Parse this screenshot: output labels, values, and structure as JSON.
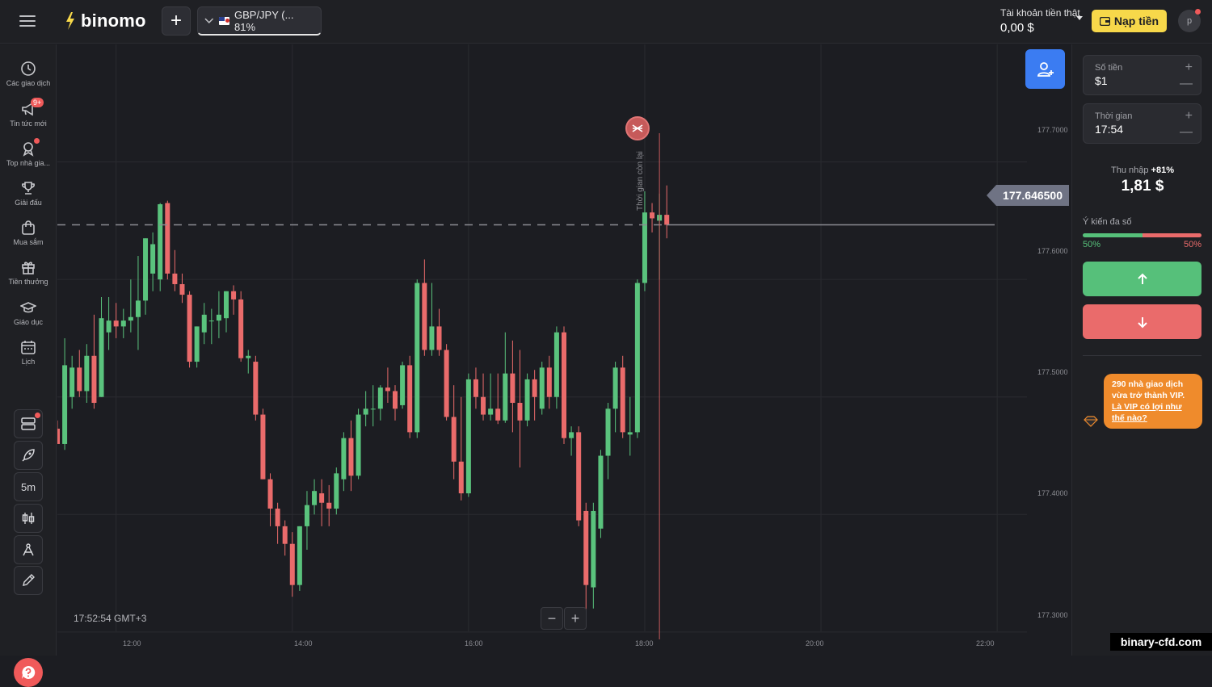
{
  "header": {
    "logo_text": "binomo",
    "asset_label": "GBP/JPY (... 81%",
    "account_type": "Tài khoản tiền thật",
    "balance": "0,00 $",
    "deposit_label": "Nạp tiền",
    "avatar_initial": "p"
  },
  "sidebar": {
    "items": [
      {
        "label": "Các giao dịch",
        "icon": "clock-icon"
      },
      {
        "label": "Tin tức mới",
        "icon": "megaphone-icon",
        "badge": "9+"
      },
      {
        "label": "Top nhà gia...",
        "icon": "medal-icon"
      },
      {
        "label": "Giải đấu",
        "icon": "trophy-icon"
      },
      {
        "label": "Mua sắm",
        "icon": "bag-icon"
      },
      {
        "label": "Tiền thưởng",
        "icon": "gift-icon"
      },
      {
        "label": "Giáo dục",
        "icon": "graduation-cap-icon"
      },
      {
        "label": "Lịch",
        "icon": "calendar-icon"
      }
    ],
    "tools": {
      "timeframe": "5m"
    }
  },
  "chart": {
    "current_price": "177.646500",
    "clock": "17:52:54 GMT+3",
    "time_remaining_label": "Thời gian còn lại",
    "y_ticks": [
      "177.7000",
      "177.6000",
      "177.5000",
      "177.4000",
      "177.3000"
    ],
    "x_ticks": [
      "12:00",
      "14:00",
      "16:00",
      "18:00",
      "20:00",
      "22:00"
    ],
    "zoom_out": "−",
    "zoom_in": "+"
  },
  "chart_data": {
    "type": "candlestick",
    "title": "",
    "series": [
      {
        "name": "GBP/JPY"
      }
    ],
    "y_range": [
      177.28,
      177.8
    ],
    "x_range": [
      "11:20",
      "22:50"
    ],
    "current_price": 177.6465,
    "colors": {
      "up": "#5ac37d",
      "down": "#ea6b6b"
    },
    "candles": [
      {
        "t": "11:20",
        "o": 177.473,
        "h": 177.48,
        "l": 177.465,
        "c": 177.46
      },
      {
        "t": "11:25",
        "o": 177.46,
        "h": 177.55,
        "l": 177.455,
        "c": 177.527
      },
      {
        "t": "11:30",
        "o": 177.5,
        "h": 177.535,
        "l": 177.49,
        "c": 177.525
      },
      {
        "t": "11:35",
        "o": 177.525,
        "h": 177.54,
        "l": 177.5,
        "c": 177.505
      },
      {
        "t": "11:40",
        "o": 177.505,
        "h": 177.545,
        "l": 177.495,
        "c": 177.535
      },
      {
        "t": "11:45",
        "o": 177.535,
        "h": 177.57,
        "l": 177.49,
        "c": 177.495
      },
      {
        "t": "11:50",
        "o": 177.5,
        "h": 177.585,
        "l": 177.5,
        "c": 177.567
      },
      {
        "t": "11:55",
        "o": 177.555,
        "h": 177.585,
        "l": 177.54,
        "c": 177.565
      },
      {
        "t": "12:00",
        "o": 177.565,
        "h": 177.58,
        "l": 177.55,
        "c": 177.56
      },
      {
        "t": "12:05",
        "o": 177.56,
        "h": 177.575,
        "l": 177.55,
        "c": 177.565
      },
      {
        "t": "12:10",
        "o": 177.565,
        "h": 177.6,
        "l": 177.555,
        "c": 177.568
      },
      {
        "t": "12:15",
        "o": 177.568,
        "h": 177.62,
        "l": 177.54,
        "c": 177.582
      },
      {
        "t": "12:20",
        "o": 177.582,
        "h": 177.635,
        "l": 177.57,
        "c": 177.635
      },
      {
        "t": "12:25",
        "o": 177.605,
        "h": 177.64,
        "l": 177.59,
        "c": 177.63
      },
      {
        "t": "12:30",
        "o": 177.6,
        "h": 177.665,
        "l": 177.59,
        "c": 177.664
      },
      {
        "t": "12:35",
        "o": 177.665,
        "h": 177.667,
        "l": 177.6,
        "c": 177.605
      },
      {
        "t": "12:40",
        "o": 177.605,
        "h": 177.625,
        "l": 177.59,
        "c": 177.596
      },
      {
        "t": "12:45",
        "o": 177.596,
        "h": 177.605,
        "l": 177.58,
        "c": 177.587
      },
      {
        "t": "12:50",
        "o": 177.587,
        "h": 177.59,
        "l": 177.525,
        "c": 177.53
      },
      {
        "t": "12:55",
        "o": 177.53,
        "h": 177.56,
        "l": 177.525,
        "c": 177.56
      },
      {
        "t": "13:00",
        "o": 177.555,
        "h": 177.58,
        "l": 177.545,
        "c": 177.57
      },
      {
        "t": "13:05",
        "o": 177.565,
        "h": 177.575,
        "l": 177.545,
        "c": 177.565
      },
      {
        "t": "13:10",
        "o": 177.565,
        "h": 177.59,
        "l": 177.55,
        "c": 177.57
      },
      {
        "t": "13:15",
        "o": 177.567,
        "h": 177.59,
        "l": 177.555,
        "c": 177.59
      },
      {
        "t": "13:20",
        "o": 177.59,
        "h": 177.595,
        "l": 177.57,
        "c": 177.583
      },
      {
        "t": "13:25",
        "o": 177.583,
        "h": 177.59,
        "l": 177.53,
        "c": 177.533
      },
      {
        "t": "13:30",
        "o": 177.533,
        "h": 177.54,
        "l": 177.52,
        "c": 177.535
      },
      {
        "t": "13:35",
        "o": 177.53,
        "h": 177.535,
        "l": 177.48,
        "c": 177.485
      },
      {
        "t": "13:40",
        "o": 177.485,
        "h": 177.49,
        "l": 177.43,
        "c": 177.43
      },
      {
        "t": "13:45",
        "o": 177.43,
        "h": 177.435,
        "l": 177.39,
        "c": 177.405
      },
      {
        "t": "13:50",
        "o": 177.405,
        "h": 177.41,
        "l": 177.375,
        "c": 177.39
      },
      {
        "t": "13:55",
        "o": 177.39,
        "h": 177.395,
        "l": 177.365,
        "c": 177.375
      },
      {
        "t": "14:00",
        "o": 177.375,
        "h": 177.385,
        "l": 177.33,
        "c": 177.34
      },
      {
        "t": "14:05",
        "o": 177.34,
        "h": 177.39,
        "l": 177.335,
        "c": 177.39
      },
      {
        "t": "14:10",
        "o": 177.39,
        "h": 177.42,
        "l": 177.37,
        "c": 177.408
      },
      {
        "t": "14:15",
        "o": 177.408,
        "h": 177.43,
        "l": 177.4,
        "c": 177.42
      },
      {
        "t": "14:20",
        "o": 177.418,
        "h": 177.43,
        "l": 177.39,
        "c": 177.41
      },
      {
        "t": "14:25",
        "o": 177.41,
        "h": 177.425,
        "l": 177.39,
        "c": 177.405
      },
      {
        "t": "14:30",
        "o": 177.405,
        "h": 177.44,
        "l": 177.4,
        "c": 177.435
      },
      {
        "t": "14:35",
        "o": 177.43,
        "h": 177.47,
        "l": 177.42,
        "c": 177.465
      },
      {
        "t": "14:40",
        "o": 177.465,
        "h": 177.48,
        "l": 177.42,
        "c": 177.433
      },
      {
        "t": "14:45",
        "o": 177.433,
        "h": 177.49,
        "l": 177.43,
        "c": 177.485
      },
      {
        "t": "14:50",
        "o": 177.485,
        "h": 177.505,
        "l": 177.475,
        "c": 177.49
      },
      {
        "t": "14:55",
        "o": 177.49,
        "h": 177.51,
        "l": 177.475,
        "c": 177.49
      },
      {
        "t": "15:00",
        "o": 177.49,
        "h": 177.51,
        "l": 177.48,
        "c": 177.508
      },
      {
        "t": "15:05",
        "o": 177.508,
        "h": 177.525,
        "l": 177.495,
        "c": 177.505
      },
      {
        "t": "15:10",
        "o": 177.505,
        "h": 177.51,
        "l": 177.48,
        "c": 177.49
      },
      {
        "t": "15:15",
        "o": 177.493,
        "h": 177.53,
        "l": 177.49,
        "c": 177.527
      },
      {
        "t": "15:20",
        "o": 177.527,
        "h": 177.535,
        "l": 177.465,
        "c": 177.47
      },
      {
        "t": "15:25",
        "o": 177.47,
        "h": 177.6,
        "l": 177.465,
        "c": 177.597
      },
      {
        "t": "15:30",
        "o": 177.597,
        "h": 177.617,
        "l": 177.535,
        "c": 177.54
      },
      {
        "t": "15:35",
        "o": 177.54,
        "h": 177.597,
        "l": 177.535,
        "c": 177.56
      },
      {
        "t": "15:40",
        "o": 177.56,
        "h": 177.575,
        "l": 177.535,
        "c": 177.54
      },
      {
        "t": "15:45",
        "o": 177.54,
        "h": 177.545,
        "l": 177.48,
        "c": 177.483
      },
      {
        "t": "15:50",
        "o": 177.483,
        "h": 177.51,
        "l": 177.43,
        "c": 177.445
      },
      {
        "t": "15:55",
        "o": 177.445,
        "h": 177.5,
        "l": 177.412,
        "c": 177.418
      },
      {
        "t": "16:00",
        "o": 177.418,
        "h": 177.52,
        "l": 177.415,
        "c": 177.515
      },
      {
        "t": "16:05",
        "o": 177.515,
        "h": 177.525,
        "l": 177.49,
        "c": 177.5
      },
      {
        "t": "16:10",
        "o": 177.5,
        "h": 177.52,
        "l": 177.48,
        "c": 177.485
      },
      {
        "t": "16:15",
        "o": 177.485,
        "h": 177.52,
        "l": 177.48,
        "c": 177.49
      },
      {
        "t": "16:20",
        "o": 177.49,
        "h": 177.52,
        "l": 177.477,
        "c": 177.48
      },
      {
        "t": "16:25",
        "o": 177.48,
        "h": 177.555,
        "l": 177.478,
        "c": 177.52
      },
      {
        "t": "16:30",
        "o": 177.52,
        "h": 177.548,
        "l": 177.47,
        "c": 177.495
      },
      {
        "t": "16:35",
        "o": 177.495,
        "h": 177.54,
        "l": 177.44,
        "c": 177.48
      },
      {
        "t": "16:40",
        "o": 177.48,
        "h": 177.52,
        "l": 177.475,
        "c": 177.515
      },
      {
        "t": "16:45",
        "o": 177.515,
        "h": 177.523,
        "l": 177.48,
        "c": 177.5
      },
      {
        "t": "16:50",
        "o": 177.49,
        "h": 177.53,
        "l": 177.485,
        "c": 177.525
      },
      {
        "t": "16:55",
        "o": 177.525,
        "h": 177.535,
        "l": 177.49,
        "c": 177.5
      },
      {
        "t": "17:00",
        "o": 177.5,
        "h": 177.56,
        "l": 177.49,
        "c": 177.555
      },
      {
        "t": "17:05",
        "o": 177.555,
        "h": 177.56,
        "l": 177.46,
        "c": 177.465
      },
      {
        "t": "17:10",
        "o": 177.465,
        "h": 177.475,
        "l": 177.45,
        "c": 177.47
      },
      {
        "t": "17:15",
        "o": 177.47,
        "h": 177.475,
        "l": 177.39,
        "c": 177.395
      },
      {
        "t": "17:20",
        "o": 177.403,
        "h": 177.41,
        "l": 177.318,
        "c": 177.34
      },
      {
        "t": "17:25",
        "o": 177.338,
        "h": 177.41,
        "l": 177.32,
        "c": 177.403
      },
      {
        "t": "17:30",
        "o": 177.388,
        "h": 177.455,
        "l": 177.38,
        "c": 177.45
      },
      {
        "t": "17:35",
        "o": 177.45,
        "h": 177.495,
        "l": 177.43,
        "c": 177.49
      },
      {
        "t": "17:40",
        "o": 177.49,
        "h": 177.53,
        "l": 177.47,
        "c": 177.525
      },
      {
        "t": "17:45",
        "o": 177.525,
        "h": 177.535,
        "l": 177.465,
        "c": 177.47
      },
      {
        "t": "17:50",
        "o": 177.468,
        "h": 177.5,
        "l": 177.45,
        "c": 177.47
      },
      {
        "t": "17:55",
        "o": 177.47,
        "h": 177.6,
        "l": 177.465,
        "c": 177.597
      },
      {
        "t": "18:00",
        "o": 177.597,
        "h": 177.675,
        "l": 177.59,
        "c": 177.657
      },
      {
        "t": "18:05",
        "o": 177.657,
        "h": 177.665,
        "l": 177.64,
        "c": 177.652
      },
      {
        "t": "18:10",
        "o": 177.65,
        "h": 177.673,
        "l": 177.6,
        "c": 177.655
      },
      {
        "t": "18:15",
        "o": 177.655,
        "h": 177.68,
        "l": 177.635,
        "c": 177.6465
      }
    ]
  },
  "panel": {
    "amount_label": "Số tiền",
    "amount_value": "$1",
    "time_label": "Thời gian",
    "time_value": "17:54",
    "payout_label": "Thu nhập",
    "payout_pct": "+81%",
    "payout_value": "1,81 $",
    "sentiment_label": "Ý kiến đa số",
    "sentiment_up": 0.5,
    "sentiment_up_text": "50%",
    "sentiment_down_text": "50%",
    "promo_line1": "290 nhà giao dịch vừa trở thành VIP.",
    "promo_link": "Là VIP có lợi như thế nào?"
  },
  "watermark": "binary-cfd.com",
  "colors": {
    "brand_yellow": "#f7d84a",
    "up_green": "#56c07a",
    "down_red": "#ea6b6b",
    "accent_blue": "#3b7cf2",
    "promo_orange": "#ef8b2c"
  }
}
